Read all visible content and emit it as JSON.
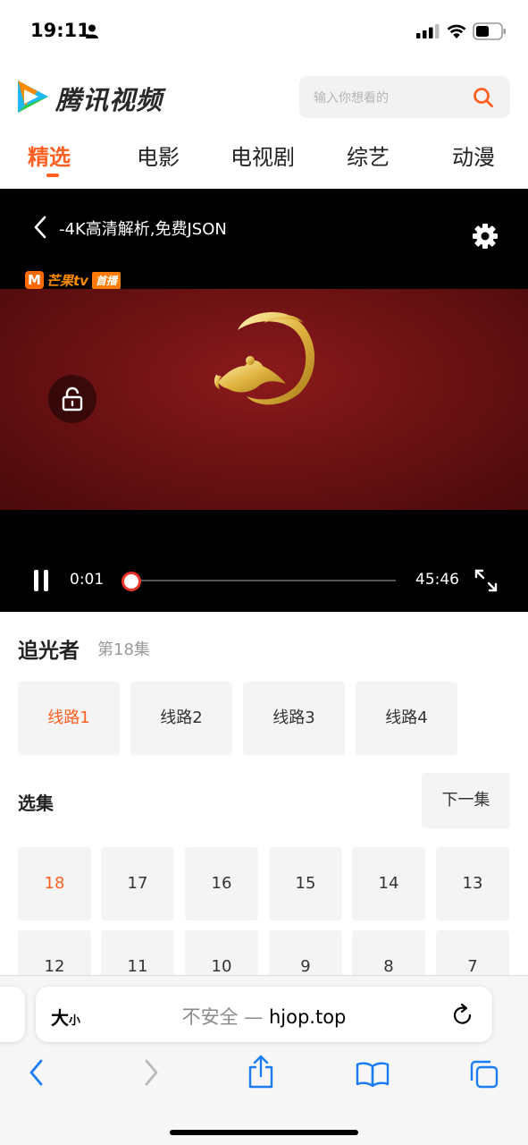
{
  "status_bar": {
    "time": "19:11"
  },
  "header": {
    "brand": "腾讯视频",
    "search_placeholder": "输入你想看的"
  },
  "nav": {
    "tabs": [
      "精选",
      "电影",
      "电视剧",
      "综艺",
      "动漫"
    ],
    "active_tab": "精选"
  },
  "player": {
    "title": "-4K高清解析,免费JSON",
    "watermark_text": "芒果tv",
    "watermark_badge": "首播",
    "current_time": "0:01",
    "duration": "45:46",
    "progress_fraction": 0.001
  },
  "show": {
    "title": "追光者",
    "episode": "第18集"
  },
  "lines": {
    "items": [
      "线路1",
      "线路2",
      "线路3",
      "线路4"
    ],
    "active": "线路1"
  },
  "episodes": {
    "label": "选集",
    "next_label": "下一集",
    "items": [
      "18",
      "17",
      "16",
      "15",
      "14",
      "13",
      "12",
      "11",
      "10",
      "9",
      "8",
      "7"
    ],
    "active": "18"
  },
  "browser": {
    "text_size_label": "大",
    "text_size_small": "小",
    "insecure_label": "不安全 —",
    "domain": "hjop.top"
  },
  "colors": {
    "accent": "#ff6022",
    "progress": "#e8352a",
    "ios_blue": "#1a7cf5"
  }
}
